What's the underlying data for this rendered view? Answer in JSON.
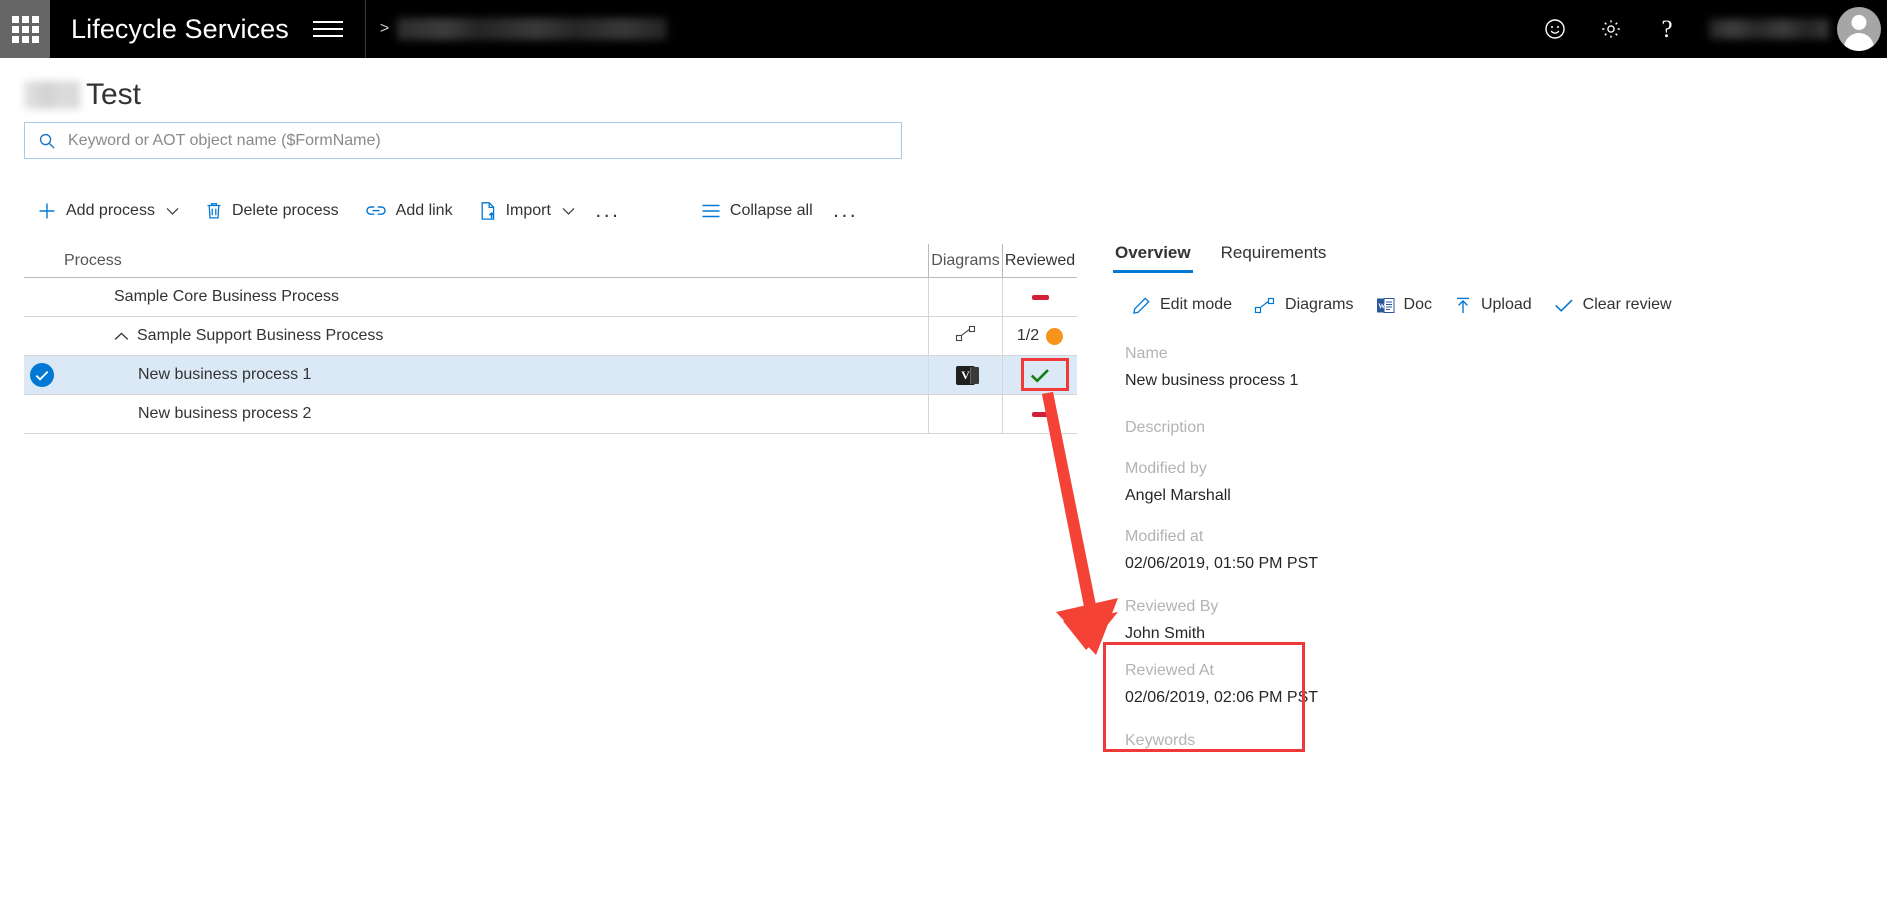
{
  "topbar": {
    "waffle_label": "app-launcher",
    "brand": "Lifecycle Services",
    "menu_label": "menu",
    "breadcrumb_separator": ">",
    "breadcrumb_blurred": "",
    "feedback_icon": "smiley-icon",
    "settings_icon": "gear-icon",
    "help_icon": "question-mark-icon",
    "user_name_blurred": "",
    "avatar_label": "user-avatar"
  },
  "page": {
    "title_prefix_blurred": "",
    "title": "Test"
  },
  "search": {
    "placeholder": "Keyword or AOT object name ($FormName)",
    "value": ""
  },
  "toolbar": {
    "items": [
      {
        "label": "Add process",
        "icon": "plus-icon",
        "has_chevron": true
      },
      {
        "label": "Delete process",
        "icon": "trash-icon",
        "has_chevron": false
      },
      {
        "label": "Add link",
        "icon": "link-icon",
        "has_chevron": false
      },
      {
        "label": "Import",
        "icon": "import-file-icon",
        "has_chevron": true
      }
    ],
    "overflow_label": "...",
    "collapse_all": {
      "label": "Collapse all",
      "icon": "list-lines-icon"
    },
    "overflow_right_label": "..."
  },
  "grid": {
    "columns": [
      "Process",
      "Diagrams",
      "Reviewed"
    ],
    "rows": [
      {
        "name": "Sample Core Business Process",
        "indent": 1,
        "expandable": false,
        "selected": false,
        "diagram": "",
        "diagram_icon": "",
        "reviewed_count": "",
        "reviewed_status": "none"
      },
      {
        "name": "Sample Support Business Process",
        "indent": 1,
        "expandable": true,
        "selected": false,
        "diagram": "",
        "diagram_icon": "diagram-shapes-icon",
        "reviewed_count": "1/2",
        "reviewed_status": "partial"
      },
      {
        "name": "New business process 1",
        "indent": 2,
        "expandable": false,
        "selected": true,
        "diagram": "",
        "diagram_icon": "visio-icon",
        "reviewed_count": "",
        "reviewed_status": "reviewed"
      },
      {
        "name": "New business process 2",
        "indent": 2,
        "expandable": false,
        "selected": false,
        "diagram": "",
        "diagram_icon": "",
        "reviewed_count": "",
        "reviewed_status": "none"
      }
    ]
  },
  "panel": {
    "tabs": [
      {
        "label": "Overview",
        "active": true
      },
      {
        "label": "Requirements",
        "active": false
      }
    ],
    "commands": [
      {
        "label": "Edit mode",
        "icon": "pencil-icon"
      },
      {
        "label": "Diagrams",
        "icon": "diagram-shapes-icon"
      },
      {
        "label": "Doc",
        "icon": "word-doc-icon"
      },
      {
        "label": "Upload",
        "icon": "upload-arrow-icon"
      },
      {
        "label": "Clear review",
        "icon": "checkmark-icon"
      }
    ],
    "fields": [
      {
        "label": "Name",
        "value": "New business process 1"
      },
      {
        "label": "Description",
        "value": ""
      },
      {
        "label": "Modified by",
        "value": "Angel Marshall"
      },
      {
        "label": "Modified at",
        "value": "02/06/2019, 01:50 PM PST"
      },
      {
        "label": "Reviewed By",
        "value": "John Smith"
      },
      {
        "label": "Reviewed At",
        "value": "02/06/2019, 02:06 PM PST"
      },
      {
        "label": "Keywords",
        "value": ""
      }
    ]
  },
  "annotations": {
    "highlight_color": "#f03a3a",
    "arrow_color": "#f44336",
    "arrow_description": "arrow-from-reviewed-cell-to-reviewed-details"
  },
  "colors": {
    "accent": "#0078d4",
    "nav_bg": "#000000",
    "selected_row": "#dbe9f7",
    "status_none": "#d6203a",
    "status_partial": "#f7941d",
    "status_reviewed": "#118011",
    "annotation_red": "#f03a3a"
  }
}
